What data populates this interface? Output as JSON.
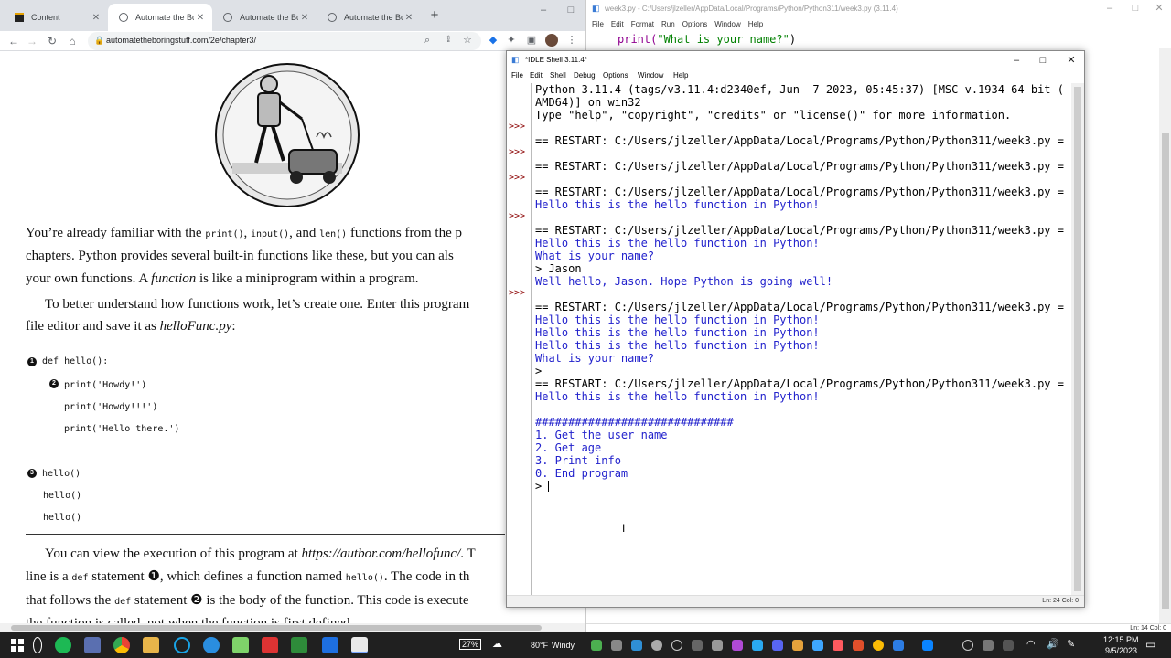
{
  "browser": {
    "tabs": [
      {
        "label": "Content",
        "active": false
      },
      {
        "label": "Automate the Boring",
        "active": true
      },
      {
        "label": "Automate the Boring",
        "active": false
      },
      {
        "label": "Automate the Boring",
        "active": false
      }
    ],
    "url": "automatetheboringstuff.com/2e/chapter3/",
    "page": {
      "para1_line1_a": "You’re already familiar with the ",
      "para1_code1": "print()",
      "para1_sep1": ", ",
      "para1_code2": "input()",
      "para1_sep2": ", and ",
      "para1_code3": "len()",
      "para1_line1_b": " functions from the p",
      "para1_line2": "chapters. Python provides several built-in functions like these, but you can als",
      "para1_line3_a": "your own functions. A ",
      "para1_line3_em": "function",
      "para1_line3_b": " is like a miniprogram within a program.",
      "para2_line1": "To better understand how functions work, let’s create one. Enter this program",
      "para2_line2_a": "file editor and save it as ",
      "para2_line2_em": "helloFunc.py",
      "para2_line2_b": ":",
      "code": {
        "b1": "1",
        "b2": "2",
        "b3": "3",
        "l1": "def hello():",
        "l2": "print('Howdy!')",
        "l3": "print('Howdy!!!')",
        "l4": "print('Hello there.')",
        "l5": "hello()",
        "l6": "hello()",
        "l7": "hello()"
      },
      "para3_line1_a": "You can view the execution of this program at ",
      "para3_line1_em": "https://autbor.com/hellofunc/",
      "para3_line1_b": ". T",
      "para3_line2_a": "line is a ",
      "para3_line2_code": "def",
      "para3_line2_b": " statement ❶, which defines a function named ",
      "para3_line2_code2": "hello()",
      "para3_line2_c": ". The code in th",
      "para3_line3_a": "that follows the ",
      "para3_line3_code": "def",
      "para3_line3_b": " statement ❷ is the body of the function. This code is execute",
      "para3_line4": "the function is called, not when the function is first defined."
    }
  },
  "editor": {
    "title": "week3.py - C:/Users/jlzeller/AppData/Local/Programs/Python/Python311/week3.py (3.11.4)",
    "menu": [
      "File",
      "Edit",
      "Format",
      "Run",
      "Options",
      "Window",
      "Help"
    ],
    "line1_fn": "print(",
    "line1_str": "\"What is your name?\"",
    "line1_end": ")",
    "status": "Ln: 14   Col: 0"
  },
  "idle": {
    "title": "*IDLE Shell 3.11.4*",
    "menu": [
      "File",
      "Edit",
      "Shell",
      "Debug",
      "Options",
      "Window",
      "Help"
    ],
    "prompt": ">>>",
    "lines": [
      {
        "t": "Python 3.11.4 (tags/v3.11.4:d2340ef, Jun  7 2023, 05:45:37) [MSC v.1934 64 bit (",
        "c": "out"
      },
      {
        "t": "AMD64)] on win32",
        "c": "out"
      },
      {
        "t": "Type \"help\", \"copyright\", \"credits\" or \"license()\" for more information.",
        "c": "out"
      },
      {
        "t": "",
        "c": "out"
      },
      {
        "t": "== RESTART: C:/Users/jlzeller/AppData/Local/Programs/Python/Python311/week3.py =",
        "c": "out"
      },
      {
        "t": "",
        "c": "out"
      },
      {
        "t": "== RESTART: C:/Users/jlzeller/AppData/Local/Programs/Python/Python311/week3.py =",
        "c": "out"
      },
      {
        "t": "",
        "c": "out"
      },
      {
        "t": "== RESTART: C:/Users/jlzeller/AppData/Local/Programs/Python/Python311/week3.py =",
        "c": "out"
      },
      {
        "t": "Hello this is the hello function in Python!",
        "c": "blu"
      },
      {
        "t": "",
        "c": "out"
      },
      {
        "t": "== RESTART: C:/Users/jlzeller/AppData/Local/Programs/Python/Python311/week3.py =",
        "c": "out"
      },
      {
        "t": "Hello this is the hello function in Python!",
        "c": "blu"
      },
      {
        "t": "What is your name?",
        "c": "blu"
      },
      {
        "t": "> Jason",
        "c": "out"
      },
      {
        "t": "Well hello, Jason. Hope Python is going well!",
        "c": "blu"
      },
      {
        "t": "",
        "c": "out"
      },
      {
        "t": "== RESTART: C:/Users/jlzeller/AppData/Local/Programs/Python/Python311/week3.py =",
        "c": "out"
      },
      {
        "t": "Hello this is the hello function in Python!",
        "c": "blu"
      },
      {
        "t": "Hello this is the hello function in Python!",
        "c": "blu"
      },
      {
        "t": "Hello this is the hello function in Python!",
        "c": "blu"
      },
      {
        "t": "What is your name?",
        "c": "blu"
      },
      {
        "t": ">",
        "c": "out"
      },
      {
        "t": "== RESTART: C:/Users/jlzeller/AppData/Local/Programs/Python/Python311/week3.py =",
        "c": "out"
      },
      {
        "t": "Hello this is the hello function in Python!",
        "c": "blu"
      },
      {
        "t": "",
        "c": "out"
      },
      {
        "t": "##############################",
        "c": "blu"
      },
      {
        "t": "1. Get the user name",
        "c": "blu"
      },
      {
        "t": "2. Get age",
        "c": "blu"
      },
      {
        "t": "3. Print info",
        "c": "blu"
      },
      {
        "t": "0. End program",
        "c": "blu"
      },
      {
        "t": "> ",
        "c": "out"
      }
    ],
    "status": "Ln: 24   Col: 0"
  },
  "taskbar": {
    "battery": "27%",
    "weather_temp": "80°F",
    "weather_desc": "Windy",
    "time": "12:15 PM",
    "date": "9/5/2023"
  },
  "colors": {
    "idle_output": "#2222cc",
    "idle_prompt": "#8b0000",
    "taskbar": "#202020"
  }
}
